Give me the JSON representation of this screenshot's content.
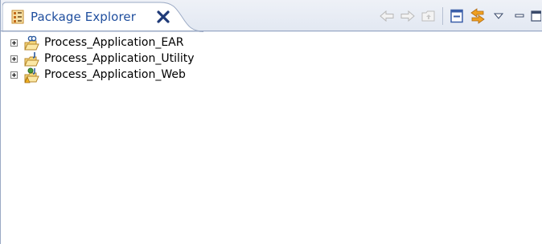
{
  "view": {
    "tab_label": "Package Explorer"
  },
  "toolbar": {
    "items": [
      "back-icon",
      "forward-icon",
      "up-icon",
      "collapse-all-icon",
      "link-with-editor-icon",
      "view-menu-icon",
      "minimize-icon",
      "maximize-icon"
    ]
  },
  "tree": {
    "items": [
      {
        "label": "Process_Application_EAR",
        "icon": "ear-project-icon",
        "expanded": false
      },
      {
        "label": "Process_Application_Utility",
        "icon": "java-project-icon",
        "expanded": false
      },
      {
        "label": "Process_Application_Web",
        "icon": "web-project-icon",
        "expanded": false
      }
    ]
  },
  "colors": {
    "tab_label": "#1f4e9e",
    "border": "#9aa9c4",
    "background": "#ffffff"
  }
}
